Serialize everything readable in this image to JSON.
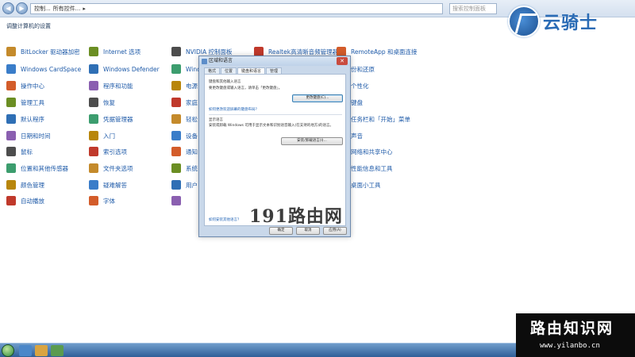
{
  "address_bar": {
    "crumbs": [
      "控制...",
      "所有控件...",
      "▸"
    ],
    "search_placeholder": "搜索控制面板"
  },
  "brand": {
    "text": "云骑士"
  },
  "page_title": "调整计算机的设置",
  "control_panel": {
    "columns": [
      [
        "BitLocker 驱动器加密",
        "Windows CardSpace",
        "操作中心",
        "管理工具",
        "默认程序",
        "日期和时间",
        "鼠标",
        "位置和其他传感器",
        "颜色管理",
        "自动播放"
      ],
      [
        "Internet 选项",
        "Windows Defender",
        "程序和功能",
        "恢复",
        "凭据管理器",
        "入门",
        "索引选项",
        "文件夹选项",
        "疑难解答",
        "字体"
      ],
      [
        "NVIDIA 控制面板",
        "Wind",
        "电源",
        "家庭",
        "轻松",
        "设备",
        "通知",
        "系统",
        "用户",
        ""
      ],
      [
        "Realtek高清晰音频管理器",
        "",
        "",
        "",
        "",
        "",
        "",
        "",
        "",
        ""
      ],
      [
        "RemoteApp 和桌面连接",
        "份和还原",
        "个性化",
        "键盘",
        "任务栏和「开始」菜单",
        "声音",
        "网络和共享中心",
        "性能信息和工具",
        "桌面小工具",
        ""
      ]
    ],
    "icon_colors": [
      "#c48a2b",
      "#3a7dc9",
      "#d35c2a",
      "#6b8e23",
      "#2f6fb5",
      "#8a5fb0",
      "#4d4d4d",
      "#3c9d6e",
      "#b8860b",
      "#c0392b"
    ]
  },
  "dialog": {
    "title": "区域和语言",
    "close_label": "✕",
    "tabs": [
      "格式",
      "位置",
      "键盘和语言",
      "管理"
    ],
    "active_tab": 2,
    "keyboard_heading": "键盘和其他输入语言",
    "keyboard_desc": "要更改键盘或输入语言，请单击「更改键盘」。",
    "change_keyboard_button": "更改键盘(C)...",
    "keyboard_link": "如何更改欢迎屏幕的键盘布局？",
    "display_heading": "显示语言",
    "display_desc_1": "安装或卸载 Windows 可用于显示文本和识别语音输入(在支持的地方)的语言。",
    "install_button": "安装/卸载语言(I)...",
    "bottom_link": "如何安装其他语言？",
    "ok_label": "确定",
    "cancel_label": "取消",
    "apply_label": "应用(A)"
  },
  "watermark": "191路由网",
  "promo": {
    "title": "路由知识网",
    "url": "www.yilanbo.cn"
  }
}
